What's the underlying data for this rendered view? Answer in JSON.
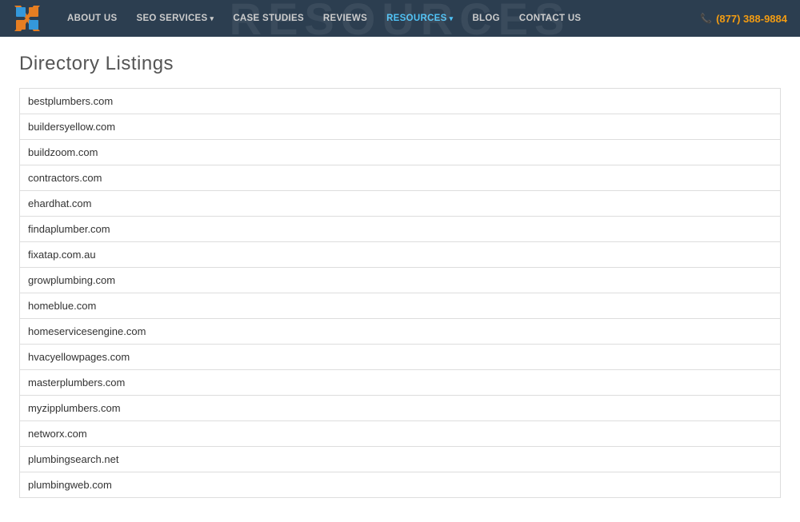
{
  "nav": {
    "logo_alt": "Logo",
    "items": [
      {
        "label": "ABOUT US",
        "active": false,
        "has_dropdown": false
      },
      {
        "label": "SEO SERVICES",
        "active": false,
        "has_dropdown": true
      },
      {
        "label": "CASE STUDIES",
        "active": false,
        "has_dropdown": false
      },
      {
        "label": "REVIEWS",
        "active": false,
        "has_dropdown": false
      },
      {
        "label": "RESOURCES",
        "active": true,
        "has_dropdown": true
      },
      {
        "label": "BLOG",
        "active": false,
        "has_dropdown": false
      },
      {
        "label": "CONTACT US",
        "active": false,
        "has_dropdown": false
      }
    ],
    "phone": "(877) 388-9884",
    "hero_bg_text": "Resources"
  },
  "page": {
    "title": "Directory Listings"
  },
  "listings": [
    "bestplumbers.com",
    "buildersyellow.com",
    "buildzoom.com",
    "contractors.com",
    "ehardhat.com",
    "findaplumber.com",
    "fixatap.com.au",
    "growplumbing.com",
    "homeblue.com",
    "homeservicesengine.com",
    "hvacyellowpages.com",
    "masterplumbers.com",
    "myzipplumbers.com",
    "networx.com",
    "plumbingsearch.net",
    "plumbingweb.com"
  ]
}
